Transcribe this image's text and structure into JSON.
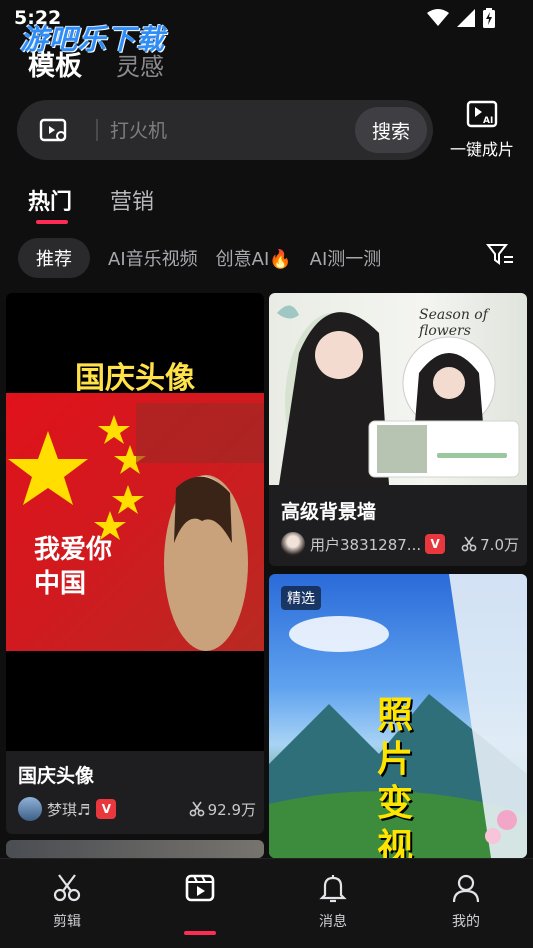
{
  "status": {
    "time": "5:22"
  },
  "watermark": "游吧乐下载",
  "header": {
    "tabs": [
      "模板",
      "灵感"
    ]
  },
  "search": {
    "placeholder": "打火机",
    "button": "搜索"
  },
  "oneclick": {
    "label": "一键成片"
  },
  "sections": [
    "热门",
    "营销"
  ],
  "chips": [
    "推荐",
    "AI音乐视频",
    "创意AI🔥",
    "AI测一测"
  ],
  "cards": [
    {
      "title": "国庆头像",
      "poster_heading": "国庆头像",
      "poster_text": "我爱你中国",
      "user": "梦琪♬",
      "badge": "V",
      "uses": "92.9万"
    },
    {
      "title": "高级背景墙",
      "poster_text": "Season of flowers",
      "user": "用户3831287...",
      "badge": "V",
      "uses": "7.0万"
    },
    {
      "tag": "精选",
      "poster_text": "照片变视"
    }
  ],
  "nav": [
    {
      "label": "剪辑",
      "icon": "scissors-icon"
    },
    {
      "label": "",
      "icon": "template-icon"
    },
    {
      "label": "消息",
      "icon": "bell-icon"
    },
    {
      "label": "我的",
      "icon": "user-icon"
    }
  ],
  "colors": {
    "accent": "#fe2c55",
    "background": "#0f0f10",
    "badge": "#e8383d"
  }
}
